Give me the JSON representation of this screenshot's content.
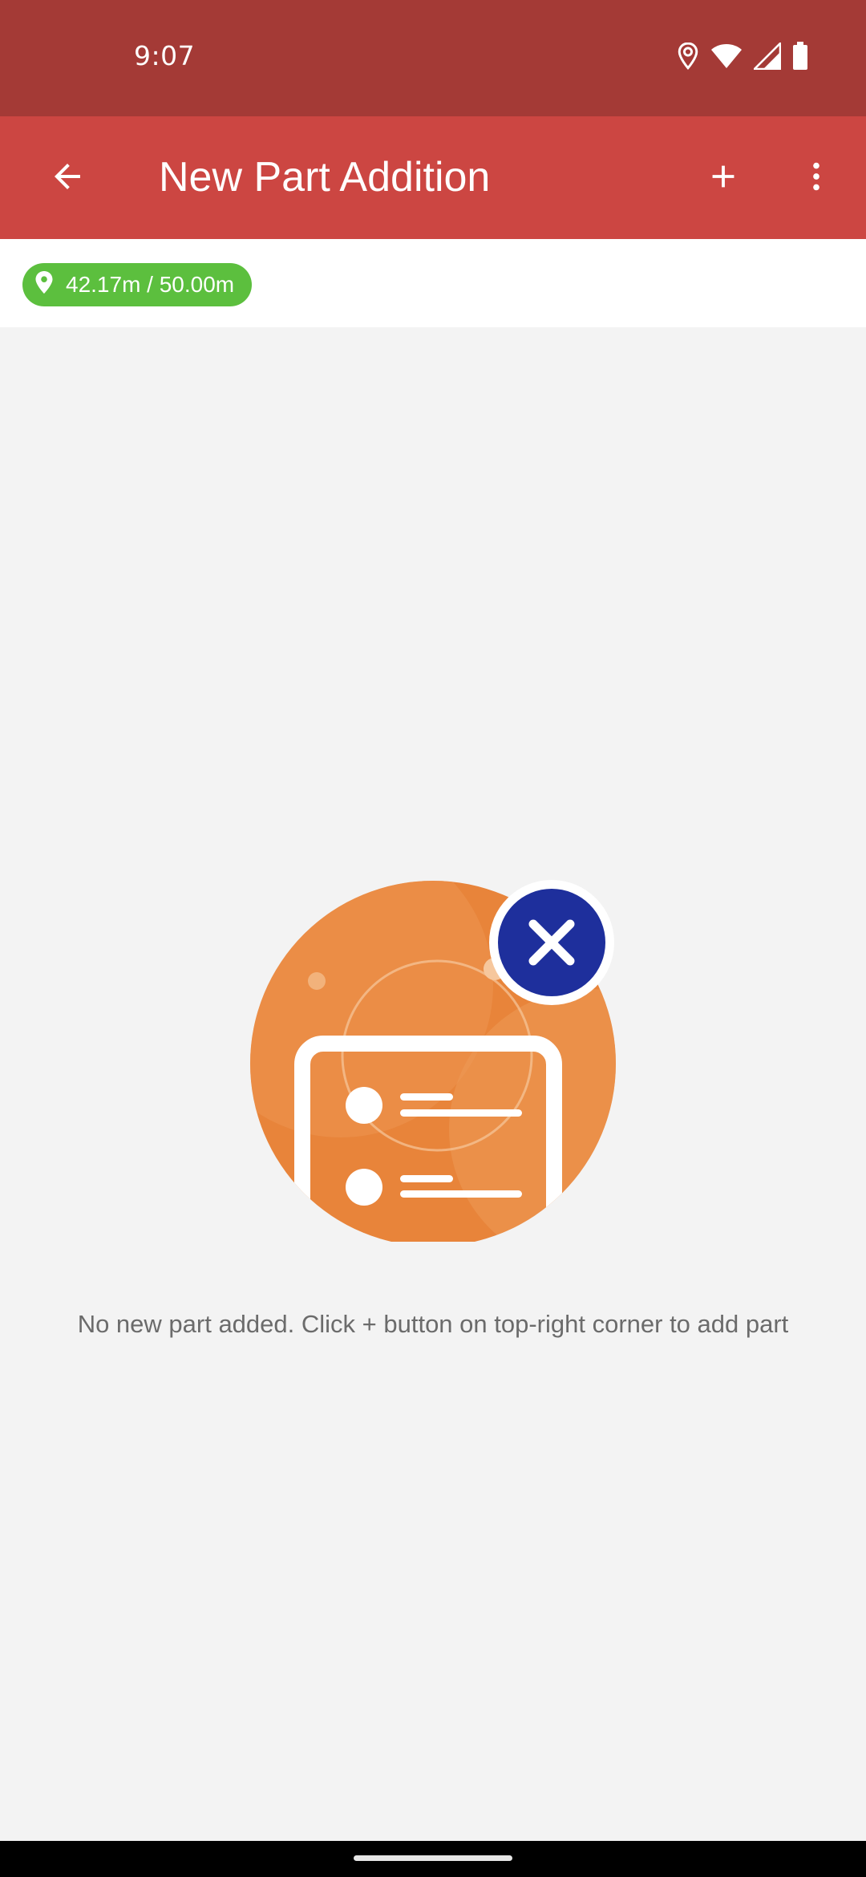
{
  "status_bar": {
    "time": "9:07",
    "icons": [
      "location-icon",
      "wifi-icon",
      "cell-signal-icon",
      "battery-icon"
    ]
  },
  "app_bar": {
    "title": "New Part Addition",
    "back_icon": "arrow-back-icon",
    "add_icon": "plus-icon",
    "more_icon": "more-vert-icon"
  },
  "location": {
    "icon": "map-pin-icon",
    "distance_text": "42.17m / 50.00m"
  },
  "empty_state": {
    "illustration": "empty-list-illustration",
    "message": "No new part added. Click + button on top-right corner to add part"
  },
  "colors": {
    "status_bar": "#a43a36",
    "app_bar": "#cc4642",
    "badge": "#5cbf3e",
    "illustration_orange": "#e8843a",
    "illustration_blue": "#1e2f9c",
    "background": "#f3f3f3"
  }
}
